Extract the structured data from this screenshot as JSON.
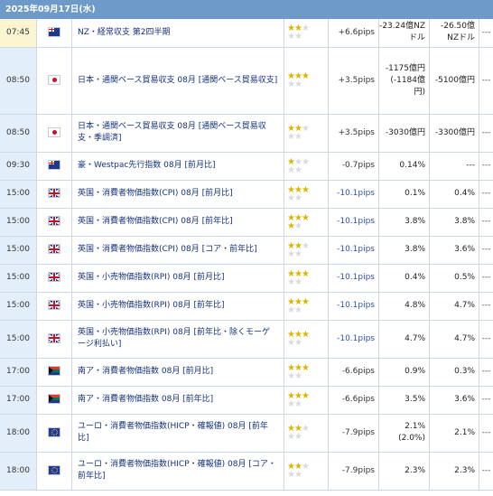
{
  "header": {
    "date": "2025年09月17日(水)"
  },
  "colors": {
    "header_bg": "#6d9ac8",
    "time_bg": "#e2eef9",
    "active_time_bg": "#fbf5d2",
    "star_on": "#d9b600",
    "star_off": "#d7dbe0",
    "indicator_link": "#15317e",
    "negative_pips": "#2d4fb3"
  },
  "rows": [
    {
      "time": "07:45",
      "country_icon": "nz-flag-icon",
      "indicator": "NZ・経常収支 第2四半期",
      "importance": 2,
      "pips": "+6.6pips",
      "actual": "-23.24億NZドル",
      "forecast": "-26.50億NZドル",
      "previous": "---",
      "active": true
    },
    {
      "time": "08:50",
      "country_icon": "jp-flag-icon",
      "indicator": "日本・通関ベース貿易収支 08月 [通関ベース貿易収支]",
      "importance": 3,
      "pips": "+3.5pips",
      "actual": "-1175億円(-1184億円)",
      "forecast": "-5100億円",
      "previous": "---"
    },
    {
      "time": "08:50",
      "country_icon": "jp-flag-icon",
      "indicator": "日本・通関ベース貿易収支 08月 [通関ベース貿易収支・季調済]",
      "importance": 2,
      "pips": "+3.5pips",
      "actual": "-3030億円",
      "forecast": "-3300億円",
      "previous": "---"
    },
    {
      "time": "09:30",
      "country_icon": "au-flag-icon",
      "indicator": "豪・Westpac先行指数 08月 [前月比]",
      "importance": 1,
      "pips": "-0.7pips",
      "actual": "0.14%",
      "forecast": "---",
      "previous": "---"
    },
    {
      "time": "15:00",
      "country_icon": "gb-flag-icon",
      "indicator": "英国・消費者物価指数(CPI) 08月 [前月比]",
      "importance": 3,
      "pips": "-10.1pips",
      "actual": "0.1%",
      "forecast": "0.4%",
      "previous": "---"
    },
    {
      "time": "15:00",
      "country_icon": "gb-flag-icon",
      "indicator": "英国・消費者物価指数(CPI) 08月 [前年比]",
      "importance": 4,
      "pips": "-10.1pips",
      "actual": "3.8%",
      "forecast": "3.8%",
      "previous": "---"
    },
    {
      "time": "15:00",
      "country_icon": "gb-flag-icon",
      "indicator": "英国・消費者物価指数(CPI) 08月 [コア・前年比]",
      "importance": 2,
      "pips": "-10.1pips",
      "actual": "3.8%",
      "forecast": "3.6%",
      "previous": "---"
    },
    {
      "time": "15:00",
      "country_icon": "gb-flag-icon",
      "indicator": "英国・小売物価指数(RPI) 08月 [前月比]",
      "importance": 3,
      "pips": "-10.1pips",
      "actual": "0.4%",
      "forecast": "0.5%",
      "previous": "---"
    },
    {
      "time": "15:00",
      "country_icon": "gb-flag-icon",
      "indicator": "英国・小売物価指数(RPI) 08月 [前年比]",
      "importance": 3,
      "pips": "-10.1pips",
      "actual": "4.8%",
      "forecast": "4.7%",
      "previous": "---"
    },
    {
      "time": "15:00",
      "country_icon": "gb-flag-icon",
      "indicator": "英国・小売物価指数(RPI) 08月 [前年比・除くモーゲージ利払い]",
      "importance": 3,
      "pips": "-10.1pips",
      "actual": "4.7%",
      "forecast": "4.7%",
      "previous": "---"
    },
    {
      "time": "17:00",
      "country_icon": "za-flag-icon",
      "indicator": "南ア・消費者物価指数 08月 [前月比]",
      "importance": 3,
      "pips": "-6.6pips",
      "actual": "0.9%",
      "forecast": "0.3%",
      "previous": "---"
    },
    {
      "time": "17:00",
      "country_icon": "za-flag-icon",
      "indicator": "南ア・消費者物価指数 08月 [前年比]",
      "importance": 3,
      "pips": "-6.6pips",
      "actual": "3.5%",
      "forecast": "3.6%",
      "previous": "---"
    },
    {
      "time": "18:00",
      "country_icon": "eu-flag-icon",
      "indicator": "ユーロ・消費者物価指数(HICP・確報値) 08月 [前年比]",
      "importance": 2,
      "pips": "-7.9pips",
      "actual": "2.1%(2.0%)",
      "forecast": "2.1%",
      "previous": "---"
    },
    {
      "time": "18:00",
      "country_icon": "eu-flag-icon",
      "indicator": "ユーロ・消費者物価指数(HICP・確報値) 08月 [コア・前年比]",
      "importance": 2,
      "pips": "-7.9pips",
      "actual": "2.3%",
      "forecast": "2.3%",
      "previous": "---"
    }
  ]
}
